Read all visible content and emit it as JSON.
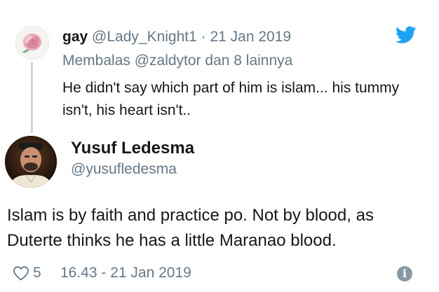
{
  "reply": {
    "name": "gay",
    "handle": "@Lady_Knight1",
    "separator": " · ",
    "date": "21 Jan 2019",
    "replying_to": "Membalas @zaldytor dan 8 lainnya",
    "text": "He didn't say which part  of him is islam... his tummy isn't, his heart isn't..",
    "avatar_icon": "rose-avatar",
    "brand_icon": "twitter-bird-icon"
  },
  "tweet": {
    "name": "Yusuf Ledesma",
    "handle": "@yusufledesma",
    "text": "Islam is by faith and practice po. Not by blood, as Duterte thinks he has a little Maranao blood.",
    "avatar_icon": "person-avatar"
  },
  "footer": {
    "like_count": "5",
    "timestamp": "16.43 - 21 Jan 2019",
    "heart_icon": "heart-outline-icon",
    "info_icon": "info-icon",
    "info_glyph": "i"
  },
  "colors": {
    "text_primary": "#14171a",
    "text_secondary": "#657786",
    "twitter_blue": "#1da1f2",
    "thread_line": "#ccd6dd",
    "info_gray": "#8899a6"
  }
}
